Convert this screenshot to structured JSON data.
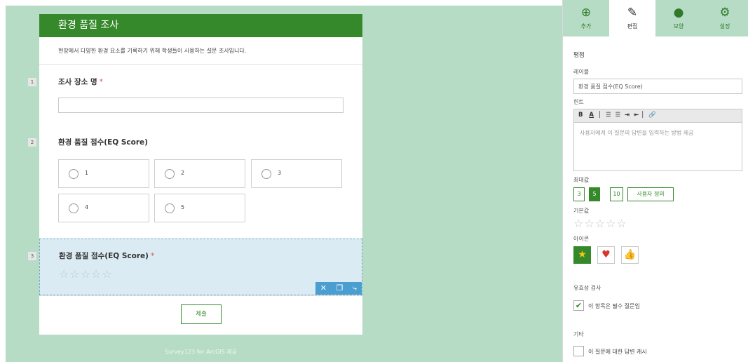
{
  "form": {
    "title": "환경 품질 조사",
    "description": "현장에서 다양한 환경 요소를 기록하기 위해 학생들이 사용하는 설문 조사입니다.",
    "questions": [
      {
        "number": "1",
        "title": "조사 장소 명",
        "required_mark": "*"
      },
      {
        "number": "2",
        "title": "환경 품질 점수(EQ Score)",
        "choices": [
          "1",
          "2",
          "3",
          "4",
          "5"
        ]
      },
      {
        "number": "3",
        "title": "환경 품질 점수(EQ Score)",
        "required_mark": "*",
        "rating_value": 0,
        "rating_max": 5
      }
    ],
    "submit_label": "제출",
    "footer": "Survey123 for ArcGIS 제공",
    "tools": [
      "close-icon",
      "copy-icon",
      "move-icon"
    ]
  },
  "panel": {
    "tabs": [
      {
        "label": "추가",
        "icon": "plus-circle-icon"
      },
      {
        "label": "편집",
        "icon": "pencil-icon",
        "active": true
      },
      {
        "label": "모양",
        "icon": "palette-icon"
      },
      {
        "label": "설정",
        "icon": "settings-icon"
      }
    ],
    "section_title": "평점",
    "label_caption": "레이블",
    "label_value": "환경 품질 점수(EQ Score)",
    "hint_caption": "힌트",
    "hint_placeholder": "사용자에게 이 질문의 답변을 입력하는 방법 제공",
    "rte_tools": [
      "B",
      "A",
      "list-ol-icon",
      "list-ul-icon",
      "indent-icon",
      "outdent-icon",
      "link-icon"
    ],
    "max_caption": "최대값",
    "max_options": [
      "3",
      "5",
      "10",
      "사용자 정의"
    ],
    "max_selected": "5",
    "default_caption": "기본값",
    "default_stars": 5,
    "icon_caption": "아이콘",
    "icon_options": [
      "star-icon",
      "heart-icon",
      "thumbs-up-icon"
    ],
    "icon_selected": "star-icon",
    "validation_caption": "유효성 검사",
    "required_label": "이 항목은 필수 질문임",
    "required_checked": true,
    "other_caption": "기타",
    "cache_label": "이 질문에 대한 답변 캐시",
    "cache_checked": false
  },
  "colors": {
    "brand_green": "#35892b",
    "canvas_bg": "#b6dcc5",
    "selected_question_bg": "#dbebf3",
    "tools_blue": "#4b9fd0"
  }
}
